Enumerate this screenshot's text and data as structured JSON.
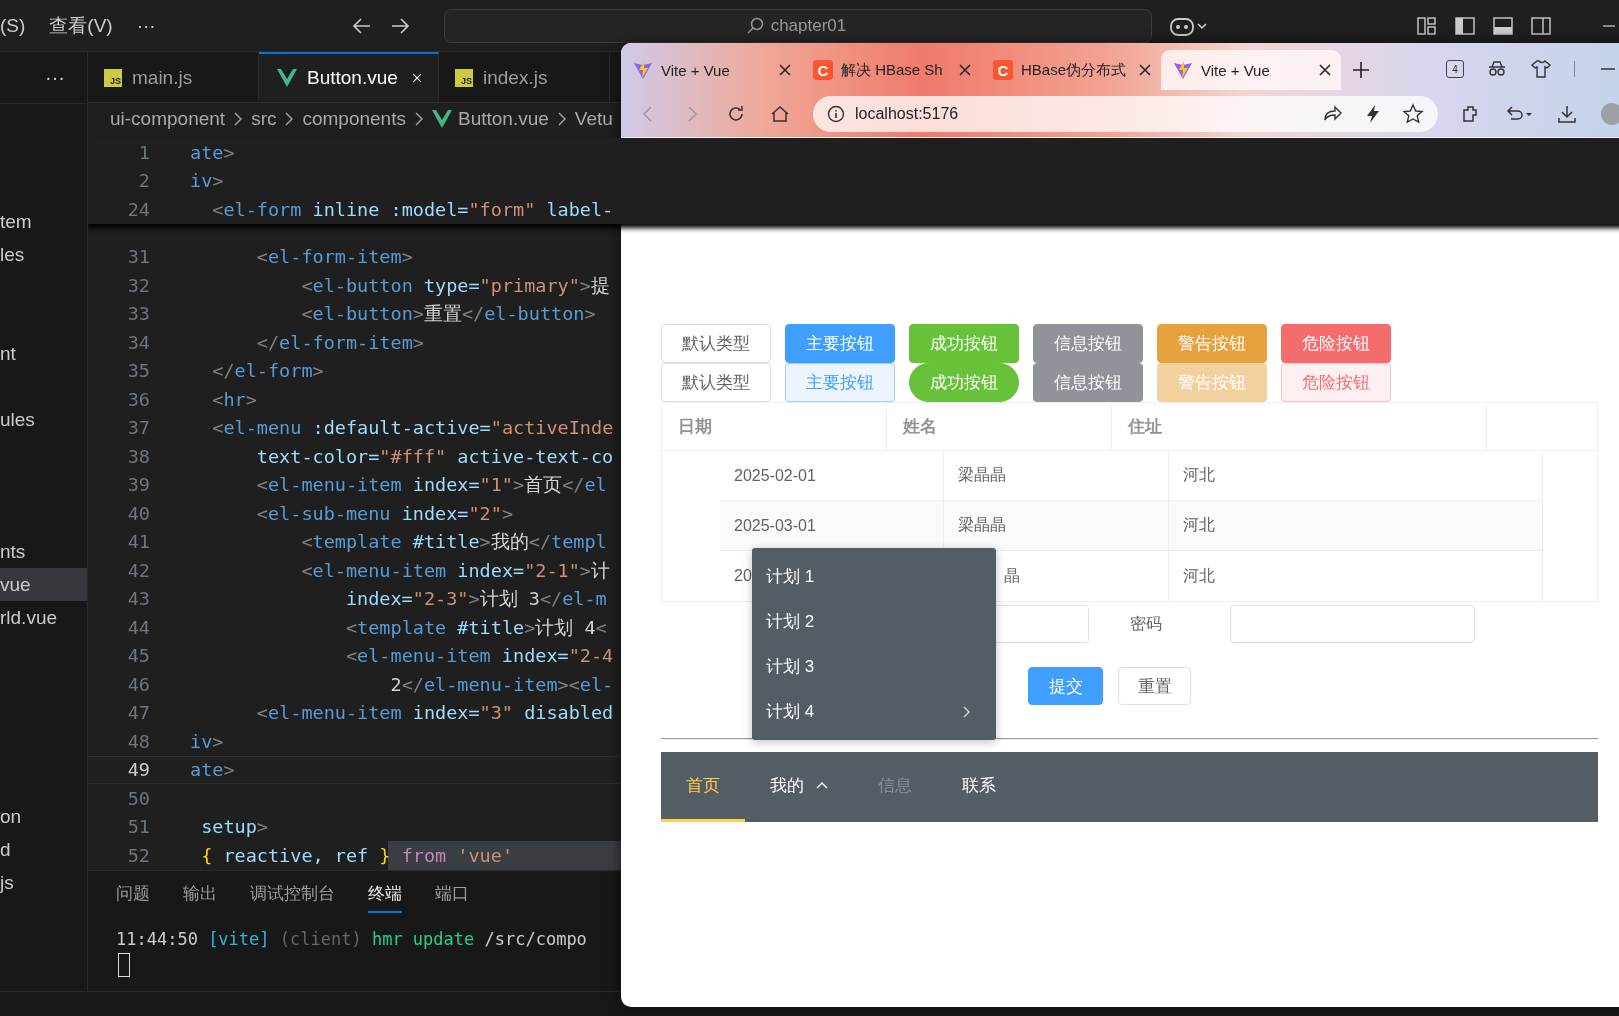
{
  "editor_window": {
    "menu": [
      "(S)",
      "查看(V)",
      "···"
    ],
    "command_center": "chapter01",
    "sidebar": {
      "more": "···",
      "items": [
        {
          "label": "tem",
          "selected": false
        },
        {
          "label": "les",
          "selected": false
        },
        {
          "label": "nt",
          "selected": false
        },
        {
          "label": "ules",
          "selected": false
        },
        {
          "label": "nts",
          "selected": false
        },
        {
          "label": "vue",
          "selected": true
        },
        {
          "label": "rld.vue",
          "selected": false
        },
        {
          "label": "on",
          "selected": false
        },
        {
          "label": "d",
          "selected": false
        },
        {
          "label": "js",
          "selected": false
        }
      ]
    },
    "tabs": [
      {
        "label": "main.js",
        "kind": "js",
        "badge": "JS",
        "selected": false
      },
      {
        "label": "Button.vue",
        "kind": "vue",
        "selected": true
      },
      {
        "label": "index.js",
        "kind": "js",
        "badge": "JS",
        "selected": false
      }
    ],
    "breadcrumb": [
      {
        "label": "ui-component",
        "kind": "folder"
      },
      {
        "label": "src",
        "kind": "folder"
      },
      {
        "label": "components",
        "kind": "folder"
      },
      {
        "label": "Button.vue",
        "kind": "vue"
      },
      {
        "label": "Vetu",
        "kind": "folder"
      }
    ],
    "sticky_lines": [
      {
        "number": "1",
        "tokens": [
          {
            "kind": "tag",
            "text": "ate"
          },
          {
            "kind": "punct",
            "text": ">"
          }
        ]
      },
      {
        "number": "2",
        "tokens": [
          {
            "kind": "tag",
            "text": "iv"
          },
          {
            "kind": "punct",
            "text": ">"
          }
        ]
      },
      {
        "number": "24",
        "tokens": [
          {
            "kind": "punct",
            "text": "  <"
          },
          {
            "kind": "tag",
            "text": "el-form"
          },
          {
            "kind": "attr",
            "text": " inline :model="
          },
          {
            "kind": "string",
            "text": "\"form\""
          },
          {
            "kind": "attr",
            "text": " label-"
          }
        ]
      }
    ],
    "lines": [
      {
        "number": "31",
        "current": false,
        "selected": false,
        "tokens": [
          {
            "kind": "punct",
            "text": "      <"
          },
          {
            "kind": "tag",
            "text": "el-form-item"
          },
          {
            "kind": "punct",
            "text": ">"
          }
        ]
      },
      {
        "number": "32",
        "current": false,
        "selected": false,
        "tokens": [
          {
            "kind": "punct",
            "text": "          <"
          },
          {
            "kind": "tag",
            "text": "el-button"
          },
          {
            "kind": "attr",
            "text": " type="
          },
          {
            "kind": "string",
            "text": "\"primary\""
          },
          {
            "kind": "punct",
            "text": ">"
          },
          {
            "kind": "text",
            "text": "提"
          }
        ]
      },
      {
        "number": "33",
        "current": false,
        "selected": false,
        "tokens": [
          {
            "kind": "punct",
            "text": "          <"
          },
          {
            "kind": "tag",
            "text": "el-button"
          },
          {
            "kind": "punct",
            "text": ">"
          },
          {
            "kind": "text",
            "text": "重置"
          },
          {
            "kind": "punct",
            "text": "</"
          },
          {
            "kind": "tag",
            "text": "el-button"
          },
          {
            "kind": "punct",
            "text": ">"
          }
        ]
      },
      {
        "number": "34",
        "current": false,
        "selected": false,
        "tokens": [
          {
            "kind": "punct",
            "text": "      </"
          },
          {
            "kind": "tag",
            "text": "el-form-item"
          },
          {
            "kind": "punct",
            "text": ">"
          }
        ]
      },
      {
        "number": "35",
        "current": false,
        "selected": false,
        "tokens": [
          {
            "kind": "punct",
            "text": "  </"
          },
          {
            "kind": "tag",
            "text": "el-form"
          },
          {
            "kind": "punct",
            "text": ">"
          }
        ]
      },
      {
        "number": "36",
        "current": false,
        "selected": false,
        "tokens": [
          {
            "kind": "punct",
            "text": "  <"
          },
          {
            "kind": "tag",
            "text": "hr"
          },
          {
            "kind": "punct",
            "text": ">"
          }
        ]
      },
      {
        "number": "37",
        "current": false,
        "selected": false,
        "tokens": [
          {
            "kind": "punct",
            "text": "  <"
          },
          {
            "kind": "tag",
            "text": "el-menu"
          },
          {
            "kind": "attr",
            "text": " :default-active="
          },
          {
            "kind": "string",
            "text": "\"activeInde"
          }
        ]
      },
      {
        "number": "38",
        "current": false,
        "selected": false,
        "tokens": [
          {
            "kind": "attr",
            "text": "      text-color="
          },
          {
            "kind": "string",
            "text": "\"#fff\""
          },
          {
            "kind": "attr",
            "text": " active-text-co"
          }
        ]
      },
      {
        "number": "39",
        "current": false,
        "selected": false,
        "tokens": [
          {
            "kind": "punct",
            "text": "      <"
          },
          {
            "kind": "tag",
            "text": "el-menu-item"
          },
          {
            "kind": "attr",
            "text": " index="
          },
          {
            "kind": "string",
            "text": "\"1\""
          },
          {
            "kind": "punct",
            "text": ">"
          },
          {
            "kind": "text",
            "text": "首页"
          },
          {
            "kind": "punct",
            "text": "</"
          },
          {
            "kind": "tag",
            "text": "el"
          }
        ]
      },
      {
        "number": "40",
        "current": false,
        "selected": false,
        "tokens": [
          {
            "kind": "punct",
            "text": "      <"
          },
          {
            "kind": "tag",
            "text": "el-sub-menu"
          },
          {
            "kind": "attr",
            "text": " index="
          },
          {
            "kind": "string",
            "text": "\"2\""
          },
          {
            "kind": "punct",
            "text": ">"
          }
        ]
      },
      {
        "number": "41",
        "current": false,
        "selected": false,
        "tokens": [
          {
            "kind": "punct",
            "text": "          <"
          },
          {
            "kind": "tag",
            "text": "template"
          },
          {
            "kind": "attr",
            "text": " #title"
          },
          {
            "kind": "punct",
            "text": ">"
          },
          {
            "kind": "text",
            "text": "我的"
          },
          {
            "kind": "punct",
            "text": "</"
          },
          {
            "kind": "tag",
            "text": "templ"
          }
        ]
      },
      {
        "number": "42",
        "current": false,
        "selected": false,
        "tokens": [
          {
            "kind": "punct",
            "text": "          <"
          },
          {
            "kind": "tag",
            "text": "el-menu-item"
          },
          {
            "kind": "attr",
            "text": " index="
          },
          {
            "kind": "string",
            "text": "\"2-1\""
          },
          {
            "kind": "punct",
            "text": ">"
          },
          {
            "kind": "text",
            "text": "计"
          }
        ]
      },
      {
        "number": "43",
        "current": false,
        "selected": false,
        "tokens": [
          {
            "kind": "attr",
            "text": "              index="
          },
          {
            "kind": "string",
            "text": "\"2-3\""
          },
          {
            "kind": "punct",
            "text": ">"
          },
          {
            "kind": "text",
            "text": "计划 3"
          },
          {
            "kind": "punct",
            "text": "</"
          },
          {
            "kind": "tag",
            "text": "el-m"
          }
        ]
      },
      {
        "number": "44",
        "current": false,
        "selected": false,
        "tokens": [
          {
            "kind": "punct",
            "text": "              <"
          },
          {
            "kind": "tag",
            "text": "template"
          },
          {
            "kind": "attr",
            "text": " #title"
          },
          {
            "kind": "punct",
            "text": ">"
          },
          {
            "kind": "text",
            "text": "计划 4"
          },
          {
            "kind": "punct",
            "text": "<"
          }
        ]
      },
      {
        "number": "45",
        "current": false,
        "selected": false,
        "tokens": [
          {
            "kind": "punct",
            "text": "              <"
          },
          {
            "kind": "tag",
            "text": "el-menu-item"
          },
          {
            "kind": "attr",
            "text": " index="
          },
          {
            "kind": "string",
            "text": "\"2-4"
          }
        ]
      },
      {
        "number": "46",
        "current": false,
        "selected": false,
        "tokens": [
          {
            "kind": "text",
            "text": "                  2"
          },
          {
            "kind": "punct",
            "text": "</"
          },
          {
            "kind": "tag",
            "text": "el-menu-item"
          },
          {
            "kind": "punct",
            "text": "><"
          },
          {
            "kind": "tag",
            "text": "el-"
          }
        ]
      },
      {
        "number": "47",
        "current": false,
        "selected": false,
        "tokens": [
          {
            "kind": "punct",
            "text": "      <"
          },
          {
            "kind": "tag",
            "text": "el-menu-item"
          },
          {
            "kind": "attr",
            "text": " index="
          },
          {
            "kind": "string",
            "text": "\"3\""
          },
          {
            "kind": "attr",
            "text": " disabled"
          }
        ]
      },
      {
        "number": "48",
        "current": false,
        "selected": false,
        "tokens": [
          {
            "kind": "tag",
            "text": "iv"
          },
          {
            "kind": "punct",
            "text": ">"
          }
        ]
      },
      {
        "number": "49",
        "current": true,
        "selected": false,
        "tokens": [
          {
            "kind": "tag",
            "text": "ate"
          },
          {
            "kind": "punct",
            "text": ">"
          }
        ]
      },
      {
        "number": "50",
        "current": false,
        "selected": false
      },
      {
        "number": "51",
        "current": false,
        "selected": false,
        "tokens": [
          {
            "kind": "attr",
            "text": " setup"
          },
          {
            "kind": "punct",
            "text": ">"
          }
        ]
      },
      {
        "number": "52",
        "current": false,
        "selected": true,
        "tokens": [
          {
            "kind": "brace",
            "text": " {"
          },
          {
            "kind": "attr",
            "text": " reactive, ref "
          },
          {
            "kind": "brace",
            "text": "}"
          },
          {
            "kind": "keyword",
            "text": " from"
          },
          {
            "kind": "string",
            "text": " 'vue'"
          }
        ]
      }
    ],
    "panel": {
      "tabs": [
        {
          "label": "问题",
          "selected": false
        },
        {
          "label": "输出",
          "selected": false
        },
        {
          "label": "调试控制台",
          "selected": false
        },
        {
          "label": "终端",
          "selected": true
        },
        {
          "label": "端口",
          "selected": false
        }
      ],
      "terminal": [
        {
          "kind": "time",
          "text": "11:44:50 "
        },
        {
          "kind": "vite",
          "text": "[vite]"
        },
        {
          "kind": "dim",
          "text": " (client)"
        },
        {
          "kind": "green",
          "text": " hmr update"
        },
        {
          "kind": "plain",
          "text": " /src/compo"
        }
      ]
    }
  },
  "browser": {
    "tabs": [
      {
        "title": "Vite + Vue",
        "kind": "vite",
        "selected": false
      },
      {
        "title": "解决 HBase Sh",
        "kind": "csdn",
        "logo_text": "C",
        "selected": false
      },
      {
        "title": "HBase伪分布式",
        "kind": "csdn",
        "logo_text": "C",
        "selected": false
      },
      {
        "title": "Vite + Vue",
        "kind": "vite",
        "selected": true
      }
    ],
    "tab_count": "4",
    "address": "localhost:5176",
    "page": {
      "button_rows": [
        [
          {
            "label": "默认类型",
            "kind": "default",
            "plain": false,
            "round": false,
            "disabled": false
          },
          {
            "label": "主要按钮",
            "kind": "primary",
            "plain": false,
            "round": false,
            "disabled": false
          },
          {
            "label": "成功按钮",
            "kind": "success",
            "plain": false,
            "round": false,
            "disabled": false
          },
          {
            "label": "信息按钮",
            "kind": "info",
            "plain": false,
            "round": false,
            "disabled": false
          },
          {
            "label": "警告按钮",
            "kind": "warning",
            "plain": false,
            "round": false,
            "disabled": false
          },
          {
            "label": "危险按钮",
            "kind": "danger",
            "plain": false,
            "round": false,
            "disabled": false
          }
        ],
        [
          {
            "label": "默认类型",
            "kind": "default",
            "plain": false,
            "round": false,
            "disabled": false
          },
          {
            "label": "主要按钮",
            "kind": "primary",
            "plain": true,
            "round": false,
            "disabled": false
          },
          {
            "label": "成功按钮",
            "kind": "success",
            "plain": false,
            "round": true,
            "disabled": false
          },
          {
            "label": "信息按钮",
            "kind": "info",
            "plain": false,
            "round": false,
            "disabled": false
          },
          {
            "label": "警告按钮",
            "kind": "warning",
            "plain": false,
            "round": false,
            "disabled": true
          },
          {
            "label": "危险按钮",
            "kind": "danger",
            "plain": true,
            "round": false,
            "disabled": false
          }
        ]
      ],
      "table": {
        "columns": [
          "日期",
          "姓名",
          "住址"
        ],
        "rows": [
          [
            {
              "text": "2025-02-01",
              "cut_left": false
            },
            {
              "text": "梁晶晶",
              "cut_left": false
            },
            {
              "text": "河北",
              "cut_left": false
            }
          ],
          [
            {
              "text": "2025-03-01",
              "cut_left": false
            },
            {
              "text": "梁晶晶",
              "cut_left": false
            },
            {
              "text": "河北",
              "cut_left": false
            }
          ],
          [
            {
              "text": "20",
              "cut_left": false
            },
            {
              "text": "晶",
              "cut_left": true
            },
            {
              "text": "河北",
              "cut_left": false
            }
          ]
        ]
      },
      "form": {
        "password_label": "密码",
        "submit": "提交",
        "reset": "重置"
      },
      "menu": [
        {
          "label": "首页",
          "kind": "item",
          "selected": true,
          "disabled": false
        },
        {
          "label": "我的",
          "kind": "submenu",
          "selected": false,
          "disabled": false,
          "expanded": true,
          "children": [
            {
              "label": "计划 1",
              "kind": "item"
            },
            {
              "label": "计划 2",
              "kind": "item"
            },
            {
              "label": "计划 3",
              "kind": "item"
            },
            {
              "label": "计划 4",
              "kind": "submenu"
            }
          ]
        },
        {
          "label": "信息",
          "kind": "item",
          "selected": false,
          "disabled": true
        },
        {
          "label": "联系",
          "kind": "item",
          "selected": false,
          "disabled": false
        }
      ]
    }
  }
}
